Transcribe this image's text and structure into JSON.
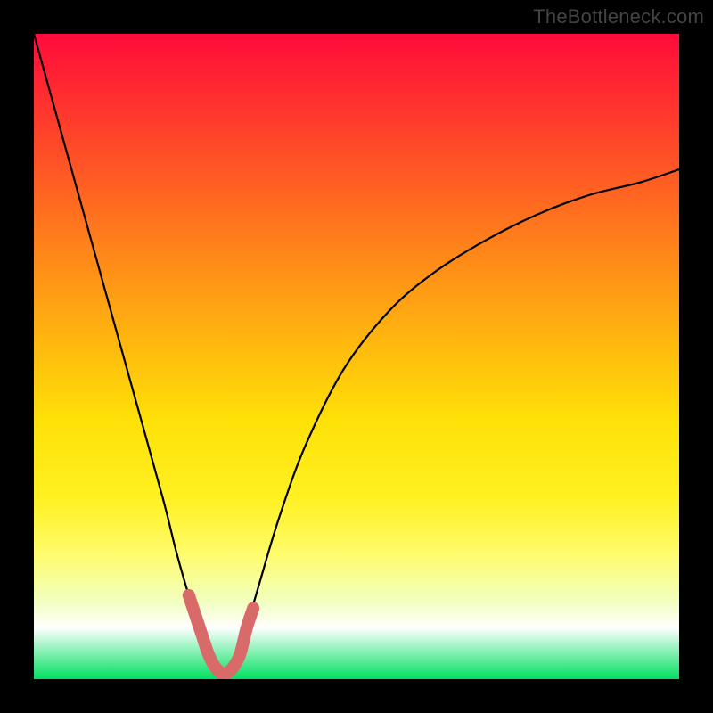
{
  "watermark": "TheBottleneck.com",
  "colors": {
    "frame_bg": "#000000",
    "curve": "#000000",
    "marker": "#d96a6a",
    "gradient_top": "#ff0b3a",
    "gradient_bottom": "#00e060"
  },
  "chart_data": {
    "type": "line",
    "title": "",
    "xlabel": "",
    "ylabel": "",
    "xlim": [
      0,
      100
    ],
    "ylim": [
      0,
      100
    ],
    "grid": false,
    "legend": false,
    "annotations": [],
    "series": [
      {
        "name": "curve",
        "x": [
          0,
          5,
          10,
          15,
          20,
          22,
          24,
          26,
          27,
          28,
          29,
          30,
          31,
          32,
          33,
          35,
          38,
          42,
          48,
          55,
          62,
          70,
          78,
          86,
          94,
          100
        ],
        "values": [
          100,
          82,
          64,
          46,
          28,
          20,
          13,
          7,
          4,
          2,
          1,
          1,
          2,
          4,
          8,
          15,
          25,
          36,
          48,
          57,
          63,
          68,
          72,
          75,
          77,
          79
        ]
      },
      {
        "name": "highlight",
        "x": [
          24,
          25,
          26,
          27,
          28,
          29,
          30,
          31,
          32,
          33,
          34
        ],
        "values": [
          13,
          10,
          7,
          4,
          2,
          1,
          1,
          2,
          4,
          8,
          11
        ]
      }
    ]
  }
}
